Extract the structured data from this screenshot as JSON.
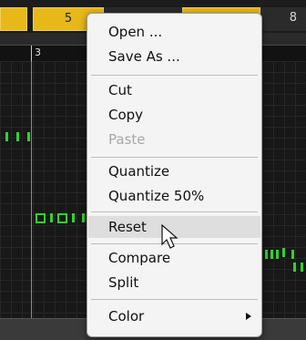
{
  "topbar": {
    "slot5_label": "5",
    "slot8_label": "8"
  },
  "ruler": {
    "bar_label": "3"
  },
  "context_menu": {
    "items": [
      {
        "label": "Open ...",
        "enabled": true
      },
      {
        "label": "Save As ...",
        "enabled": true
      },
      {
        "label": "Cut",
        "enabled": true
      },
      {
        "label": "Copy",
        "enabled": true
      },
      {
        "label": "Paste",
        "enabled": false
      },
      {
        "label": "Quantize",
        "enabled": true
      },
      {
        "label": "Quantize 50%",
        "enabled": true
      },
      {
        "label": "Reset",
        "enabled": true,
        "highlighted": true
      },
      {
        "label": "Compare",
        "enabled": true
      },
      {
        "label": "Split",
        "enabled": true
      },
      {
        "label": "Color",
        "enabled": true,
        "has_submenu": true
      }
    ]
  },
  "colors": {
    "pattern_slot": "#e7b81a",
    "note": "#2fd42f",
    "menu_bg": "#f4f4f4"
  },
  "icons": {
    "cursor": "arrow-pointer-icon",
    "submenu": "chevron-right-icon"
  }
}
